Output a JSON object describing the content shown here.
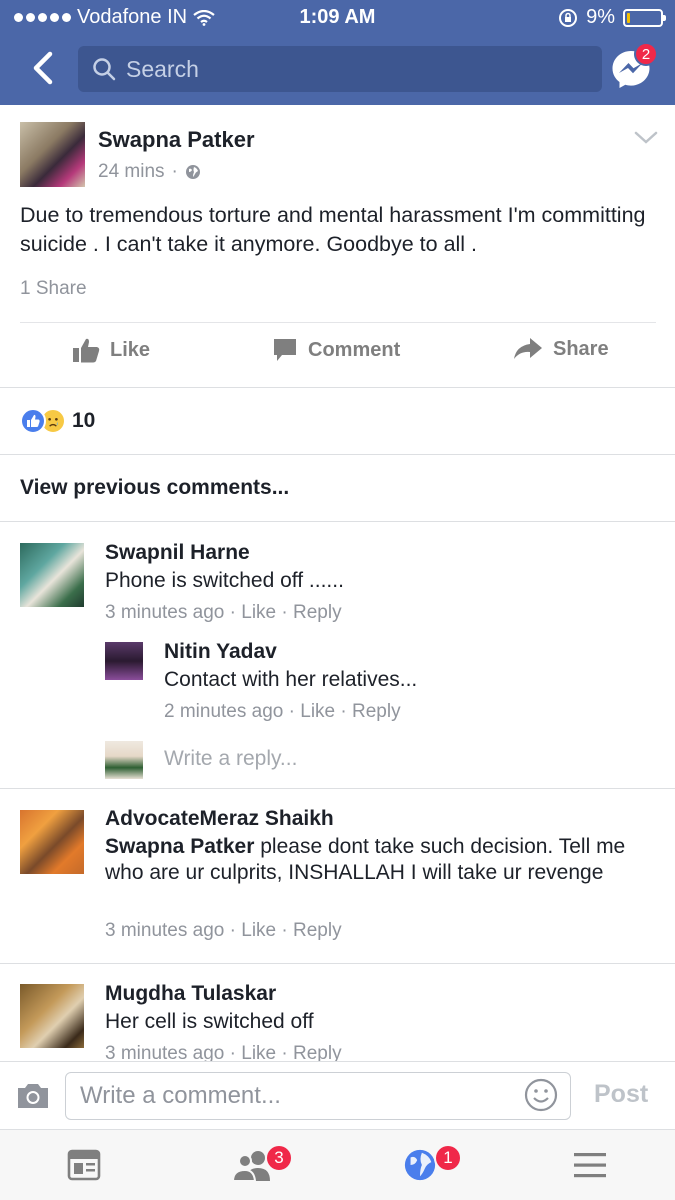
{
  "status_bar": {
    "carrier": "Vodafone IN",
    "time": "1:09 AM",
    "battery": "9%",
    "battery_level": 0.09
  },
  "header": {
    "search_placeholder": "Search",
    "messenger_badge": "2"
  },
  "post": {
    "author": "Swapna Patker",
    "time": "24 mins",
    "text": "Due to tremendous torture and mental harassment I'm committing suicide . I can't take it anymore. Goodbye to all .",
    "shares": "1 Share",
    "actions": {
      "like": "Like",
      "comment": "Comment",
      "share": "Share"
    },
    "reaction_count": "10",
    "view_previous": "View previous comments..."
  },
  "comments": [
    {
      "name": "Swapnil Harne",
      "text": "Phone is switched off ......",
      "time": "3 minutes ago",
      "like": "Like",
      "reply": "Reply"
    },
    {
      "name": "Nitin Yadav",
      "text": "Contact with her relatives...",
      "time": "2 minutes ago",
      "like": "Like",
      "reply": "Reply"
    },
    {
      "name": "AdvocateMeraz Shaikh",
      "mention": "Swapna Patker",
      "text": " please dont take such decision. Tell me who are ur culprits, INSHALLAH I will take ur revenge",
      "time": "3 minutes ago",
      "like": "Like",
      "reply": "Reply"
    },
    {
      "name": "Mugdha Tulaskar",
      "text": "Her cell is switched off",
      "time": "3 minutes ago",
      "like": "Like",
      "reply": "Reply"
    }
  ],
  "reply_placeholder": "Write a reply...",
  "separator": "·",
  "composer": {
    "placeholder": "Write a comment...",
    "post_label": "Post"
  },
  "tabbar": {
    "friends_badge": "3",
    "notifications_badge": "1"
  },
  "colors": {
    "brand": "#4b67a8",
    "badge": "#f02849",
    "meta_gray": "#90949c"
  }
}
